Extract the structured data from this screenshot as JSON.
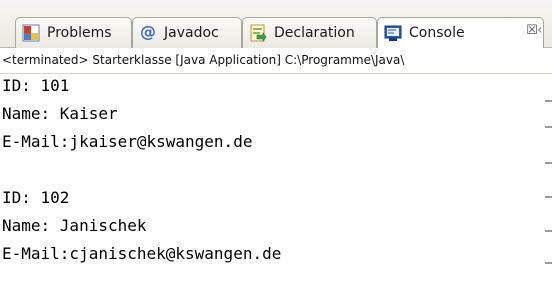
{
  "tabs": [
    {
      "label": "Problems",
      "icon": "problems-icon"
    },
    {
      "label": "Javadoc",
      "icon": "at-sign-icon"
    },
    {
      "label": "Declaration",
      "icon": "declaration-icon"
    },
    {
      "label": "Console",
      "icon": "console-icon",
      "active": true,
      "close": "☒"
    }
  ],
  "status": "<terminated> Starterklasse [Java Application] C:\\Programme\\Java\\",
  "console_lines": [
    "ID: 101",
    "Name: Kaiser",
    "E-Mail:jkaiser@kswangen.de",
    "",
    "ID: 102",
    "Name: Janischek",
    "E-Mail:cjanischek@kswangen.de"
  ]
}
